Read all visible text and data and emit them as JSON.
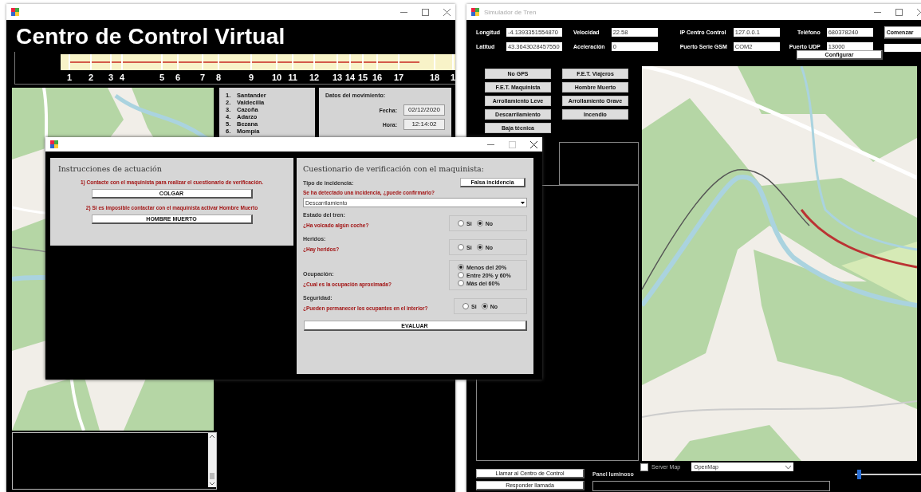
{
  "control_window": {
    "title": "Centro de Control Virtual",
    "stations": [
      "1",
      "2",
      "3",
      "4",
      "5",
      "6",
      "7",
      "8",
      "9",
      "10",
      "11",
      "12",
      "13",
      "14",
      "15",
      "16",
      "17",
      "18",
      "1"
    ],
    "station_list": [
      {
        "number": "1.",
        "name": "Santander"
      },
      {
        "number": "2.",
        "name": "Valdecilla"
      },
      {
        "number": "3.",
        "name": "Cazoña"
      },
      {
        "number": "4.",
        "name": "Adarzo"
      },
      {
        "number": "5.",
        "name": "Bezana"
      },
      {
        "number": "6.",
        "name": "Mompía"
      }
    ],
    "movement": {
      "heading": "Datos del movimiento:",
      "fields": [
        {
          "label": "Fecha:",
          "value": "02/12/2020"
        },
        {
          "label": "Hora:",
          "value": "12:14:02"
        }
      ]
    }
  },
  "simulator_window": {
    "title": "Simulador de Tren",
    "field_groups": [
      [
        {
          "label": "Longitud",
          "value": "-4.1393351554870"
        },
        {
          "label": "Latitud",
          "value": "43.3643028457550"
        }
      ],
      [
        {
          "label": "Velocidad",
          "value": "22.58"
        },
        {
          "label": "Aceleración",
          "value": "0"
        }
      ],
      [
        {
          "label": "IP Centro Control",
          "value": "127.0.0.1"
        },
        {
          "label": "Puerto Serie GSM",
          "value": "COM2"
        }
      ],
      [
        {
          "label": "Teléfono",
          "value": "680378240"
        },
        {
          "label": "Puerto UDP",
          "value": "13000"
        }
      ]
    ],
    "configure_button": "Configurar",
    "start_button": "Comenzar",
    "event_buttons": [
      "No GPS",
      "F.E.T. Viajeros",
      "F.E.T. Maquinista",
      "Hombre Muerto",
      "Arrollamiento Leve",
      "Arrollamiento Grave",
      "Descarrilamiento",
      "Incendio",
      "Baja técnica"
    ],
    "server_map": {
      "label": "Server Map",
      "checked": false
    },
    "map_select": "OpenMap",
    "call_button": "Llamar al Centro de Control",
    "answer_button": "Responder llamada",
    "panel_label": "Panel luminoso",
    "slider": {
      "level": 0.04
    }
  },
  "dialog": {
    "instructions": {
      "title": "Instrucciones de actuación",
      "steps": [
        {
          "text": "1) Contacte con el maquinista para realizar el cuestionario de verificación.",
          "button": "COLGAR"
        },
        {
          "text": "2) Si es imposible contactar con el maquinista activar Hombre Muerto",
          "button": "HOMBRE MUERTO"
        }
      ]
    },
    "questionnaire": {
      "title": "Cuestionario de verificación con el maquinista:",
      "incident": {
        "label": "Tipo de incidencia:",
        "button": "Falsa incidencia",
        "question": "Se ha detectado una incidencia, ¿puede confirmarlo?",
        "value": "Descarrilamiento"
      },
      "questions": [
        {
          "kind": "inline",
          "section": "Estado del tren:",
          "question": "¿Ha volcado algún coche?",
          "options": [
            {
              "label": "Si",
              "selected": false
            },
            {
              "label": "No",
              "selected": true
            }
          ]
        },
        {
          "kind": "inline",
          "section": "Heridos:",
          "question": "¿Hay heridos?",
          "options": [
            {
              "label": "Si",
              "selected": false
            },
            {
              "label": "No",
              "selected": true
            }
          ]
        },
        {
          "kind": "stacked",
          "section": "Ocupación:",
          "question": "¿Cual es la ocupación aproximada?",
          "options": [
            {
              "label": "Menos del 20%",
              "selected": true
            },
            {
              "label": "Entre 20% y 60%",
              "selected": false
            },
            {
              "label": "Más del 60%",
              "selected": false
            }
          ]
        },
        {
          "kind": "inline",
          "section": "Seguridad:",
          "question": "¿Pueden permanecer los ocupantes en el interior?",
          "options": [
            {
              "label": "Si",
              "selected": false
            },
            {
              "label": "No",
              "selected": true
            }
          ]
        }
      ],
      "submit_button": "EVALUAR"
    }
  }
}
